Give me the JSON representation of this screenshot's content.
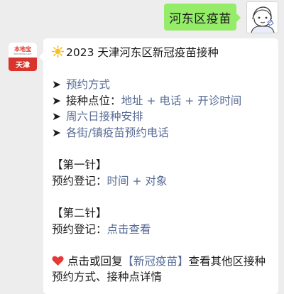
{
  "chat": {
    "outgoing_message": "河东区疫苗",
    "bot_avatar": {
      "logo_text": "本地宝",
      "logo_sub": "Bendibao.com",
      "city": "天津"
    }
  },
  "message": {
    "title": "2023 天津河东区新冠疫苗接种",
    "arrow_glyph": "➤",
    "menu": [
      {
        "text": "预约方式"
      },
      {
        "prefix": "接种点位：",
        "text": "地址 + 电话 + 开诊时间"
      },
      {
        "text": "周六日接种安排"
      },
      {
        "text": "各街/镇疫苗预约电话"
      }
    ],
    "first_dose": {
      "heading": "【第一针】",
      "label": "预约登记：",
      "link": "时间 + 对象"
    },
    "second_dose": {
      "heading": "【第二针】",
      "label": "预约登记：",
      "link": "点击查看"
    },
    "footer": {
      "prefix": "点击或回复",
      "keyword": "【新冠疫苗】",
      "suffix": "查看其他区接种预约方式、接种点详情"
    }
  }
}
